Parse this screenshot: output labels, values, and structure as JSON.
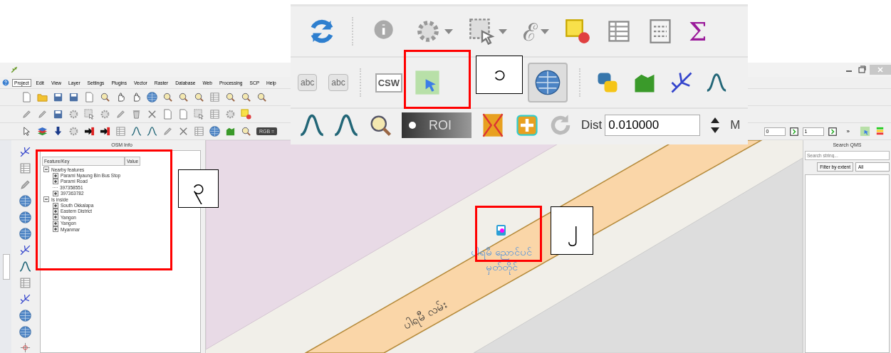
{
  "qgis_window": {
    "menu": [
      {
        "label": "Project",
        "selected": true
      },
      {
        "label": "Edit",
        "selected": false
      },
      {
        "label": "View",
        "selected": false
      },
      {
        "label": "Layer",
        "selected": false
      },
      {
        "label": "Settings",
        "selected": false
      },
      {
        "label": "Plugins",
        "selected": false
      },
      {
        "label": "Vector",
        "selected": false
      },
      {
        "label": "Raster",
        "selected": false
      },
      {
        "label": "Database",
        "selected": false
      },
      {
        "label": "Web",
        "selected": false
      },
      {
        "label": "Processing",
        "selected": false
      },
      {
        "label": "SCP",
        "selected": false
      },
      {
        "label": "Help",
        "selected": false
      }
    ],
    "toolbar": {
      "band_select": "RGB =",
      "spin_values": [
        "0",
        "1"
      ],
      "overflow": "»"
    },
    "osm_info": {
      "title": "OSM Info",
      "columns": [
        "Feature/Key",
        "Value"
      ],
      "tree": [
        {
          "label": "Nearby features",
          "expanded": true,
          "children": [
            {
              "label": "Parami Nyaung Bin Bus Stop",
              "kind": "node",
              "expanded": false
            },
            {
              "label": "Parami Road",
              "kind": "node",
              "expanded": false
            },
            {
              "label": "397358551",
              "kind": "leaf"
            },
            {
              "label": "397363782",
              "kind": "node",
              "expanded": false
            }
          ]
        },
        {
          "label": "Is inside",
          "expanded": true,
          "children": [
            {
              "label": "South Okkalapa",
              "kind": "node",
              "expanded": false
            },
            {
              "label": "Eastern District",
              "kind": "node",
              "expanded": false
            },
            {
              "label": "Yangon",
              "kind": "node",
              "expanded": false
            },
            {
              "label": "Yangon",
              "kind": "node",
              "expanded": false
            },
            {
              "label": "Myanmar",
              "kind": "node",
              "expanded": false
            }
          ]
        }
      ]
    },
    "search_qms": {
      "title": "Search QMS",
      "placeholder": "Search string...",
      "filter_button": "Filter by extent",
      "filter_select": "All"
    },
    "map": {
      "road_label": "ပါရမီ လမ်း",
      "bus_stop_label": [
        "ပါရမီ ညောင်ပင်",
        "မှတ်တိုင်"
      ]
    }
  },
  "zoomed_toolbar": {
    "abc_labels": [
      "abc",
      "abc"
    ],
    "csw_label": "CSW",
    "epsilon": "ℰ",
    "sigma": "Σ",
    "roi_label": "ROI",
    "dist_label": "Dist",
    "dist_value": "0.010000",
    "cut_label": "M",
    "globe_tool_pressed": true
  },
  "callouts": [
    {
      "number": "၁"
    },
    {
      "number": "၃"
    },
    {
      "number": "၂"
    }
  ]
}
